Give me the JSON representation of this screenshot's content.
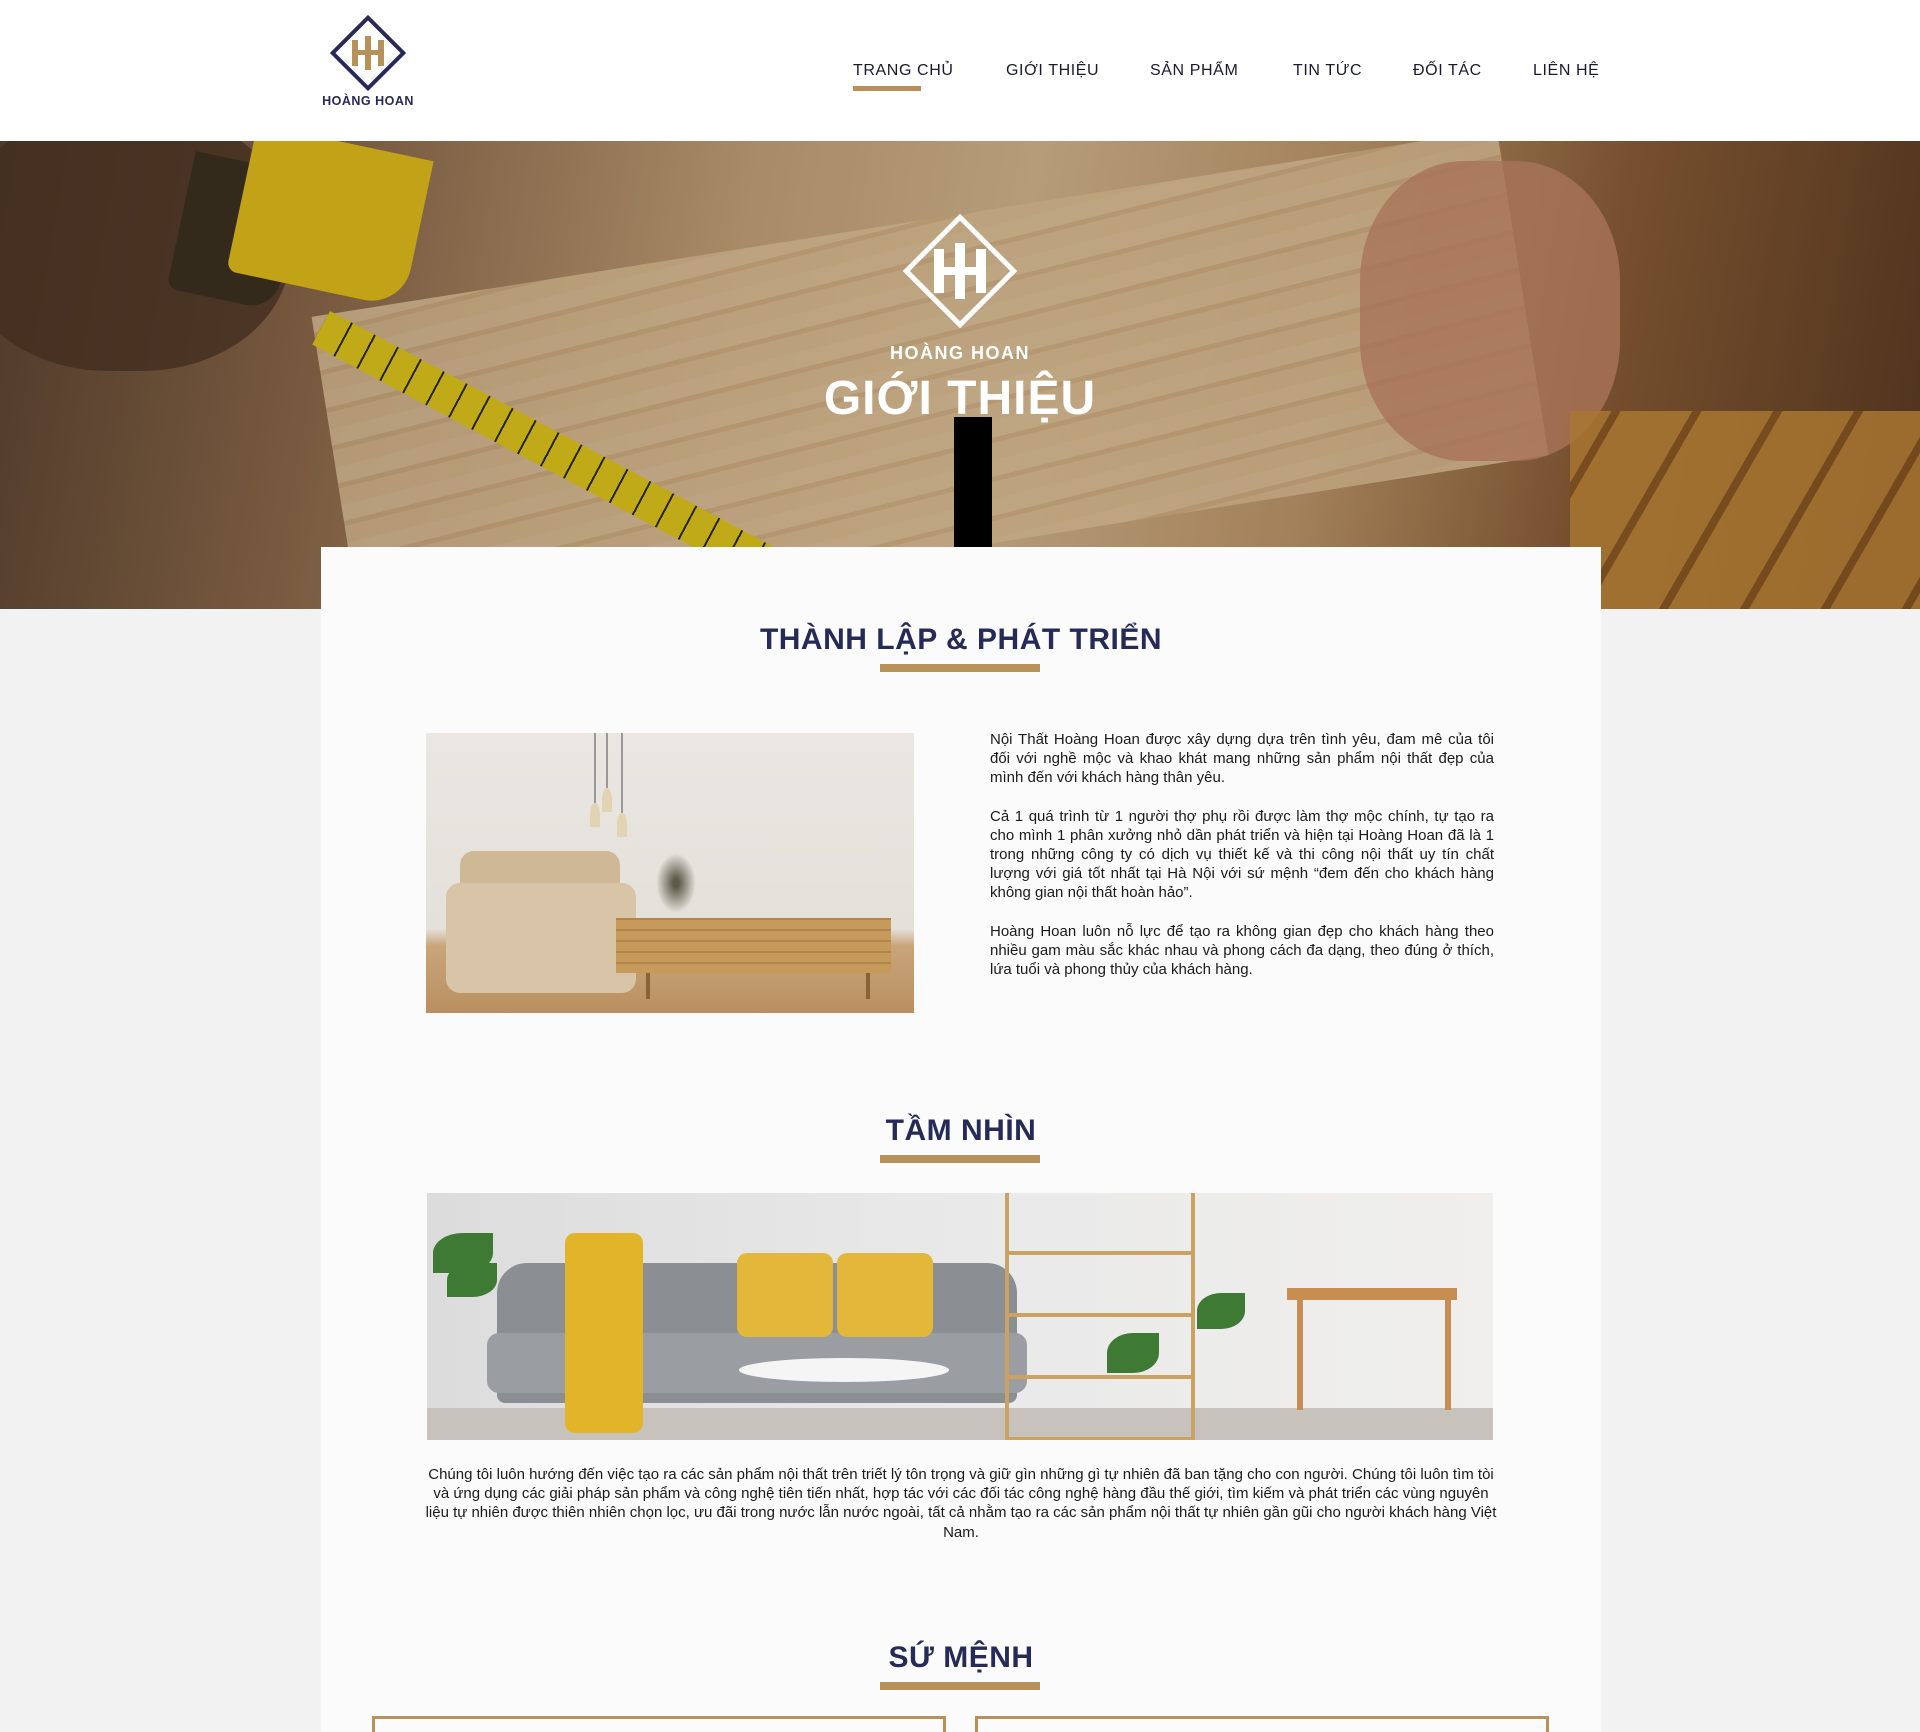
{
  "brand": {
    "name": "HOÀNG HOAN",
    "monogram": "HH"
  },
  "nav": {
    "items": [
      {
        "label": "TRANG CHỦ",
        "active": true
      },
      {
        "label": "GIỚI THIỆU",
        "active": false
      },
      {
        "label": "SẢN PHẨM",
        "active": false
      },
      {
        "label": "TIN TỨC",
        "active": false
      },
      {
        "label": "ĐỐI TÁC",
        "active": false
      },
      {
        "label": "LIÊN HỆ",
        "active": false
      }
    ]
  },
  "hero": {
    "brand": "HOÀNG HOAN",
    "title": "GIỚI THIỆU"
  },
  "about": {
    "title": "THÀNH LẬP & PHÁT TRIỂN",
    "paragraphs": [
      "Nội Thất Hoàng Hoan được xây dựng dựa trên tình yêu, đam mê của tôi đối với nghề mộc và khao khát mang những sản phẩm nội thất đẹp của mình đến với khách hàng thân yêu.",
      "Cả 1 quá trình từ 1 người thợ phụ rồi được làm thợ mộc chính, tự tạo ra cho mình 1 phân xưởng nhỏ dần phát triển và hiện tại Hoàng Hoan đã là 1 trong những công ty có dịch vụ thiết kế và thi công nội thất uy tín chất lượng với giá tốt nhất tại Hà Nội với sứ mệnh “đem đến cho khách hàng không gian nội thất hoàn hảo”.",
      "Hoàng Hoan luôn nỗ lực để tạo ra không gian đẹp cho khách hàng theo nhiều gam màu sắc khác nhau và phong cách đa dạng, theo đúng ở thích, lứa tuổi và phong thủy của khách hàng."
    ]
  },
  "vision": {
    "title": "TẦM NHÌN",
    "text": "Chúng tôi luôn hướng đến việc tạo ra các sản phẩm nội thất trên triết lý tôn trọng và giữ gìn những gì tự nhiên đã ban tặng cho con người. Chúng tôi luôn tìm tòi và ứng dụng các giải pháp sản phẩm và công nghệ tiên tiến nhất, hợp tác với các đối tác công nghệ hàng đầu thế giới, tìm kiếm và phát triển các vùng nguyên liệu tự nhiên được thiên nhiên chọn lọc, ưu đãi trong nước lẫn nước ngoài, tất cả nhằm tạo ra các sản phẩm nội thất tự nhiên gần gũi cho người khách hàng Việt Nam."
  },
  "mission": {
    "title": "SỨ MỆNH"
  },
  "colors": {
    "navy": "#262a57",
    "gold": "#b8905a"
  }
}
